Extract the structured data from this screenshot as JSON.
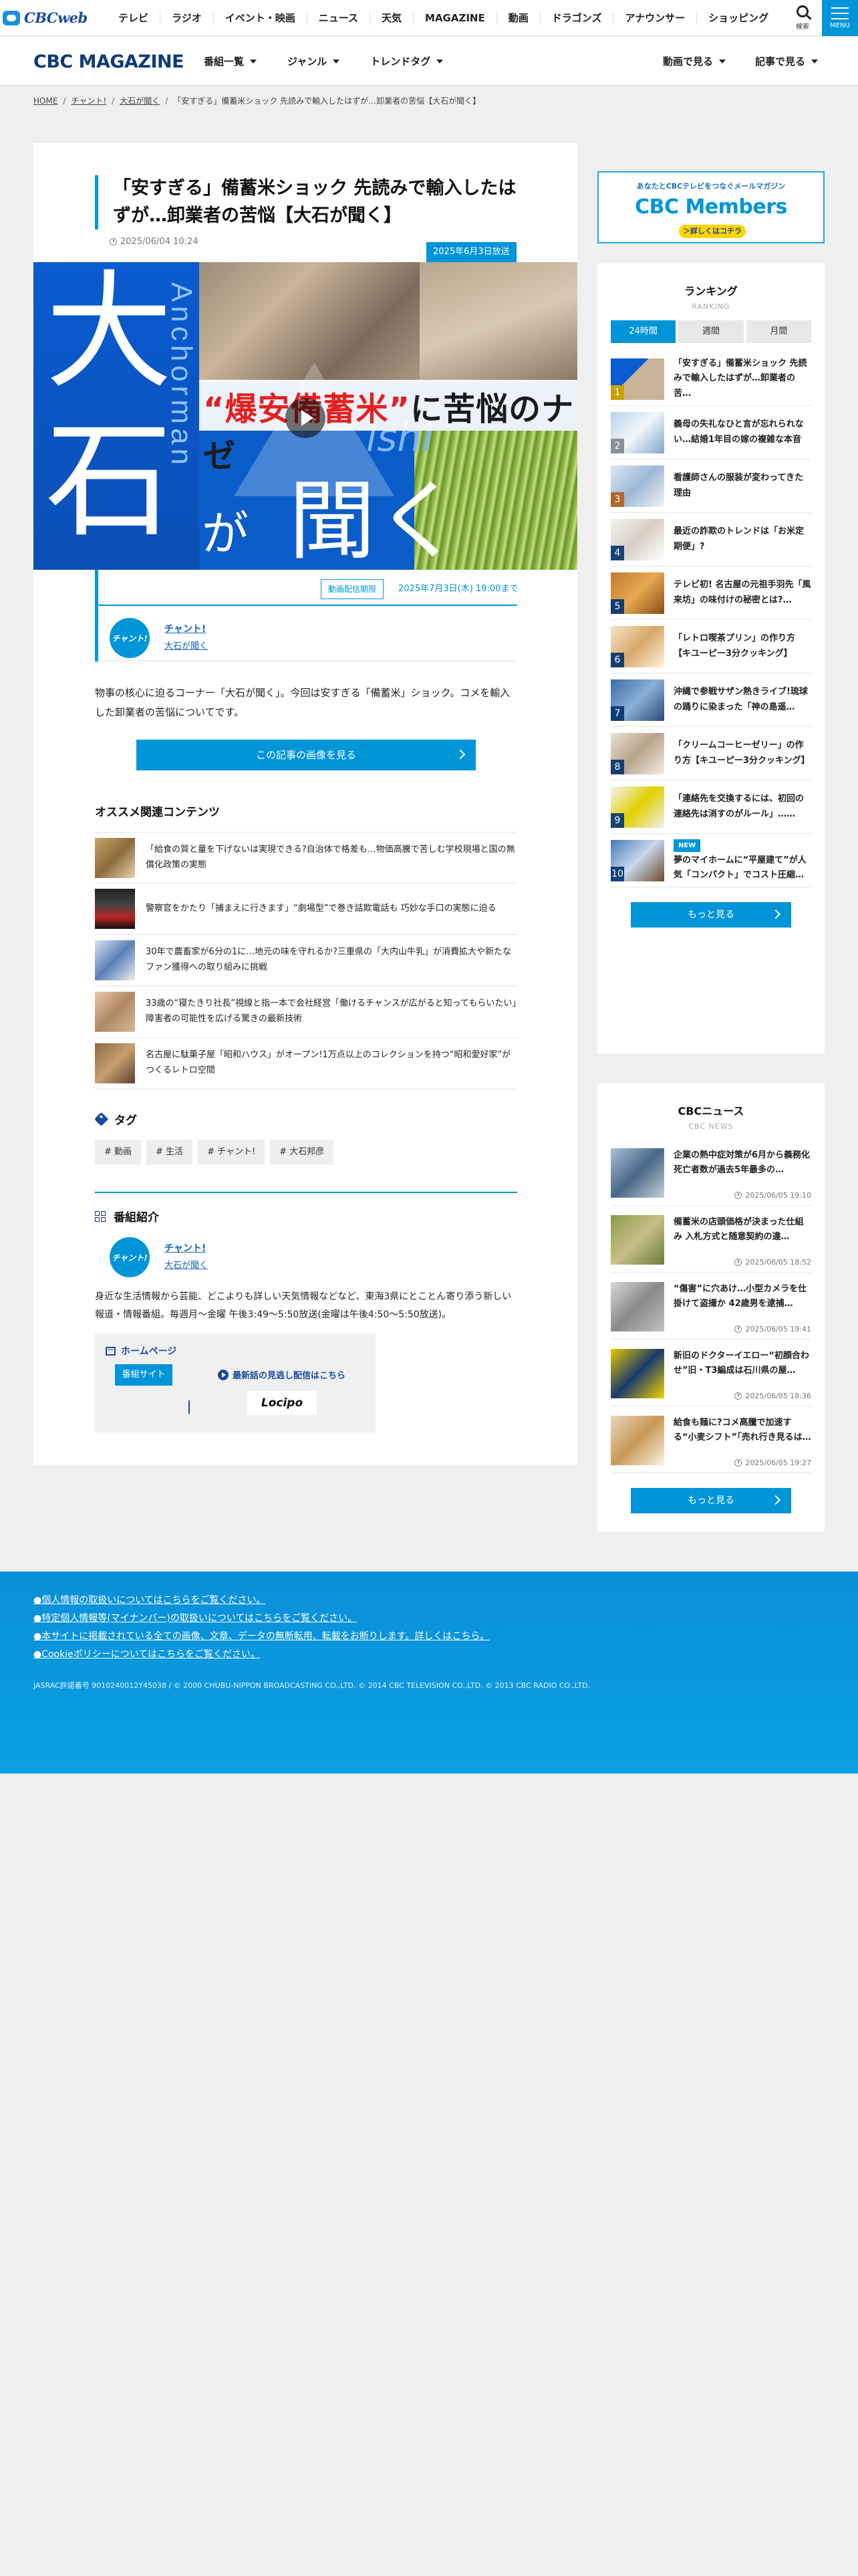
{
  "topnav": {
    "logo": "CBCweb",
    "items": [
      "テレビ",
      "ラジオ",
      "イベント・映画",
      "ニュース",
      "天気",
      "MAGAZINE",
      "動画",
      "ドラゴンズ",
      "アナウンサー",
      "ショッピング"
    ],
    "search_label": "検索",
    "menu_label": "MENU"
  },
  "magazine": {
    "title": "CBC MAGAZINE",
    "nav_left": [
      "番組一覧",
      "ジャンル",
      "トレンドタグ"
    ],
    "nav_right": [
      "動画で見る",
      "記事で見る"
    ]
  },
  "breadcrumb": [
    "HOME",
    "チャント!",
    "大石が聞く",
    "「安すぎる」備蓄米ショック 先読みで輸入したはずが…卸業者の苦悩【大石が聞く】"
  ],
  "article": {
    "title": "「安すぎる」備蓄米ショック 先読みで輸入したはずが…卸業者の苦悩【大石が聞く】",
    "date": "2025/06/04 10:24",
    "aired_badge": "2025年6月3日放送",
    "hero": {
      "kanji_top": "大",
      "kanji_bottom": "石",
      "vertical_text": "Anchorman",
      "ga": "が",
      "kiku": "聞く",
      "band_red": "“爆安備蓄米”",
      "band_dark": "に苦悩のナゼ",
      "ishi": "ishi"
    },
    "distribution_badge": "動画配信期限",
    "distribution_date": "2025年7月3日(木) 19:00まで",
    "program_logo": "チャント!",
    "program_link1": "チャント!",
    "program_link2": "大石が聞く",
    "lead": "物事の核心に迫るコーナー「大石が聞く」。今回は安すぎる「備蓄米」ショック。コメを輸入した卸業者の苦悩についてです。",
    "image_button": "この記事の画像を見る"
  },
  "recommended": {
    "heading": "オススメ関連コンテンツ",
    "items": [
      "「給食の質と量を下げないは実現できる?自治体で格差も…物価高騰で苦しむ学校現場と国の無償化政策の実態",
      "警察官をかたり「捕まえに行きます」“劇場型”で巻き詰欺電話も 巧妙な手口の実態に迫る",
      "30年で農畜家が6分の1に…地元の味を守れるか?三重県の「大内山牛乳」が消費拡大や新たなファン獲得への取り組みに挑戦",
      "33歳の“寝たきり社長”視線と指一本で会社経営「働けるチャンスが広がると知ってもらいたい」障害者の可能性を広げる驚きの最新技術",
      "名古屋に駄菓子屋「昭和ハウス」がオープン!1万点以上のコレクションを持つ“昭和愛好家”がつくるレトロ空間"
    ]
  },
  "tags": {
    "heading": "タグ",
    "items": [
      "# 動画",
      "# 生活",
      "# チャント!",
      "# 大石邦彦"
    ]
  },
  "program_intro": {
    "heading": "番組紹介",
    "logo": "チャント!",
    "link1": "チャント!",
    "link2": "大石が聞く",
    "description": "身近な生活情報から芸能、どこよりも詳しい天気情報などなど、東海3県にとことん寄り添う新しい報道・情報番組。毎週月～金曜 午後3:49～5:50放送(金曜は午後4:50～5:50放送)。",
    "homepage_title": "ホームページ",
    "site_button": "番組サイト",
    "news_label": "最新話の見逃し配信はこちら",
    "locipo": "Locipo"
  },
  "sidebar": {
    "banner_top": "あなたとCBCテレビをつなぐメールマガジン",
    "banner_main": "CBC Members",
    "banner_btn": "＞詳しくはコチラ",
    "ranking": {
      "title": "ランキング",
      "subtitle": "RANKING",
      "tabs": [
        "24時間",
        "週間",
        "月間"
      ],
      "items": [
        {
          "num": "1",
          "text": "「安すぎる」備蓄米ショック 先読みで輸入したはずが…卸業者の苦…"
        },
        {
          "num": "2",
          "text": "義母の失礼なひと言が忘れられない…結婚1年目の嫁の複雑な本音"
        },
        {
          "num": "3",
          "text": "看護師さんの服装が変わってきた理由"
        },
        {
          "num": "4",
          "text": "最近の詐欺のトレンドは「お米定期便」?"
        },
        {
          "num": "5",
          "text": "テレビ初! 名古屋の元祖手羽先「風来坊」の味付けの秘密とは?…"
        },
        {
          "num": "6",
          "text": "「レトロ喫茶プリン」の作り方【キユーピー3分クッキング】"
        },
        {
          "num": "7",
          "text": "沖縄で参戦サザン熱きライブ!琉球の踊りに染まった「神の島遥…"
        },
        {
          "num": "8",
          "text": "「クリームコーヒーゼリー」の作り方【キユーピー3分クッキング】"
        },
        {
          "num": "9",
          "text": "「連絡先を交換するには、初回の連絡先は消すのがルール」……"
        },
        {
          "num": "10",
          "text": "夢のマイホームに“平屋建て”が人気「コンパクト」でコスト圧縮…",
          "new": "NEW"
        }
      ],
      "more": "もっと見る"
    },
    "news": {
      "title": "CBCニュース",
      "subtitle": "CBC NEWS",
      "items": [
        {
          "text": "企業の熱中症対策が6月から義務化 死亡者数が過去5年最多の…",
          "date": "2025/06/05 19:10"
        },
        {
          "text": "備蓄米の店頭価格が決まった仕組み 入札方式と随意契約の違…",
          "date": "2025/06/05 18:52"
        },
        {
          "text": "“傷害”に穴あけ…小型カメラを仕掛けて盗撮か 42歳男を逮捕…",
          "date": "2025/06/05 19:41"
        },
        {
          "text": "新旧のドクターイエロー“初顔合わせ”旧・T3編成は石川県の屋…",
          "date": "2025/06/05 18:36"
        },
        {
          "text": "給食も麺に?コメ高騰で加速する“小麦シフト”「売れ行き見るは…",
          "date": "2025/06/05 19:27"
        }
      ],
      "more": "もっと見る"
    }
  },
  "footer": {
    "links": [
      "●個人情報の取扱いについてはこちらをご覧ください。",
      "●特定個人情報等(マイナンバー)の取扱いについてはこちらをご覧ください。",
      "●本サイトに掲載されている全ての画像、文章、データの無断転用、転載をお断りします。詳しくはこちら。",
      "●Cookieポリシーについてはこちらをご覧ください。"
    ],
    "copyright": "JASRAC許諾番号 9010240012Y45038 / © 2000 CHUBU-NIPPON BROADCASTING CO.,LTD. © 2014 CBC TELEVISION CO.,LTD. © 2013 CBC RADIO CO.,LTD."
  },
  "colors": {
    "accent": "#0095d9",
    "navy": "#0f3a7a"
  }
}
